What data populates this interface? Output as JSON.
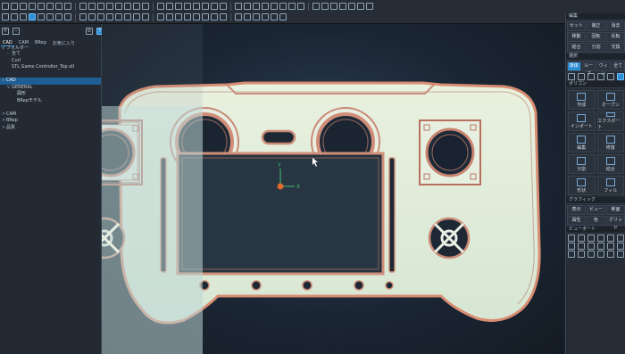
{
  "toolbar": {
    "row1_icons": [
      "new-icon",
      "open-icon",
      "save-icon",
      "cube-icon",
      "cube-icon",
      "cube-icon",
      "cube-icon",
      "zoom-icon",
      "fit-icon",
      "view-icon",
      "undo-icon",
      "redo-icon",
      "power-icon",
      "home-icon",
      "snap-icon",
      "axis-icon",
      "measure-icon",
      "grid-icon",
      "view-icon",
      "view-icon",
      "view-icon",
      "view-icon",
      "view-icon",
      "view-icon",
      "view-icon",
      "view-icon",
      "view-icon",
      "view-icon",
      "view-icon",
      "view-icon",
      "target-icon",
      "measure-icon",
      "axis-icon",
      "light-icon",
      "render-icon",
      "text-icon",
      "cursor-icon",
      "arrow-icon",
      "box-icon"
    ],
    "row2_icons": [
      "settings-icon",
      "display-icon",
      "wire-icon",
      "solid-icon",
      "shade-icon",
      "edge-icon",
      "view-icon",
      "view-icon",
      "view-icon",
      "view-icon",
      "view-icon",
      "view-icon",
      "view-icon",
      "view-icon",
      "view-icon",
      "view-icon",
      "view-icon",
      "view-icon",
      "view-icon",
      "view-icon",
      "corner-icon",
      "corner-icon",
      "corner-icon",
      "corner-icon",
      "corner-icon",
      "corner-icon",
      "corner-icon",
      "corner-icon",
      "corner-icon",
      "corner-icon"
    ]
  },
  "left_panel": {
    "tabs": [
      "CAD",
      "CAM",
      "BRep",
      "お気に入り"
    ],
    "tree_header": "フォルダー",
    "tree": [
      {
        "label": "全て",
        "indent": 1,
        "expander": "-"
      },
      {
        "label": "Curl",
        "indent": 1,
        "expander": ""
      },
      {
        "label": "STL  Game Controller_Top.stl",
        "indent": 1,
        "expander": ""
      },
      {
        "label": "",
        "indent": 0,
        "expander": ""
      },
      {
        "label": "CAD",
        "indent": 0,
        "expander": "v",
        "selected": true
      },
      {
        "label": "GENERAL",
        "indent": 1,
        "expander": "v"
      },
      {
        "label": "図形",
        "indent": 2,
        "expander": ""
      },
      {
        "label": "BRepモデル",
        "indent": 2,
        "expander": ""
      },
      {
        "label": "",
        "indent": 0,
        "expander": ""
      },
      {
        "label": "CAM",
        "indent": 0,
        "expander": ">"
      },
      {
        "label": "BRep",
        "indent": 0,
        "expander": ">"
      },
      {
        "label": "品質",
        "indent": 0,
        "expander": ">"
      }
    ]
  },
  "right_panel": {
    "section1_title": "編集",
    "section1_buttons": [
      "セット",
      "補正",
      "消去",
      "移動",
      "回転",
      "反転",
      "結合",
      "分割",
      "交換"
    ],
    "section2_title": "選択",
    "section2_buttons": [
      "単体",
      "ループ",
      "ウィン",
      "全て"
    ],
    "section3_title": "ポリゴン",
    "section3_buttons": [
      "作成",
      "オープン",
      "インポート",
      "エクスポート",
      "編集",
      "修復",
      "分割",
      "結合",
      "形状",
      "フィル"
    ],
    "section4_title": "グラフィック",
    "section4_buttons": [
      "表示",
      "ビュー",
      "断面",
      "属性",
      "色",
      "グリッド"
    ],
    "section5_title": "ビューポート"
  },
  "viewport": {
    "axis_x_label": "X",
    "axis_y_label": "Y",
    "accent_color": "#2f8fd6"
  }
}
